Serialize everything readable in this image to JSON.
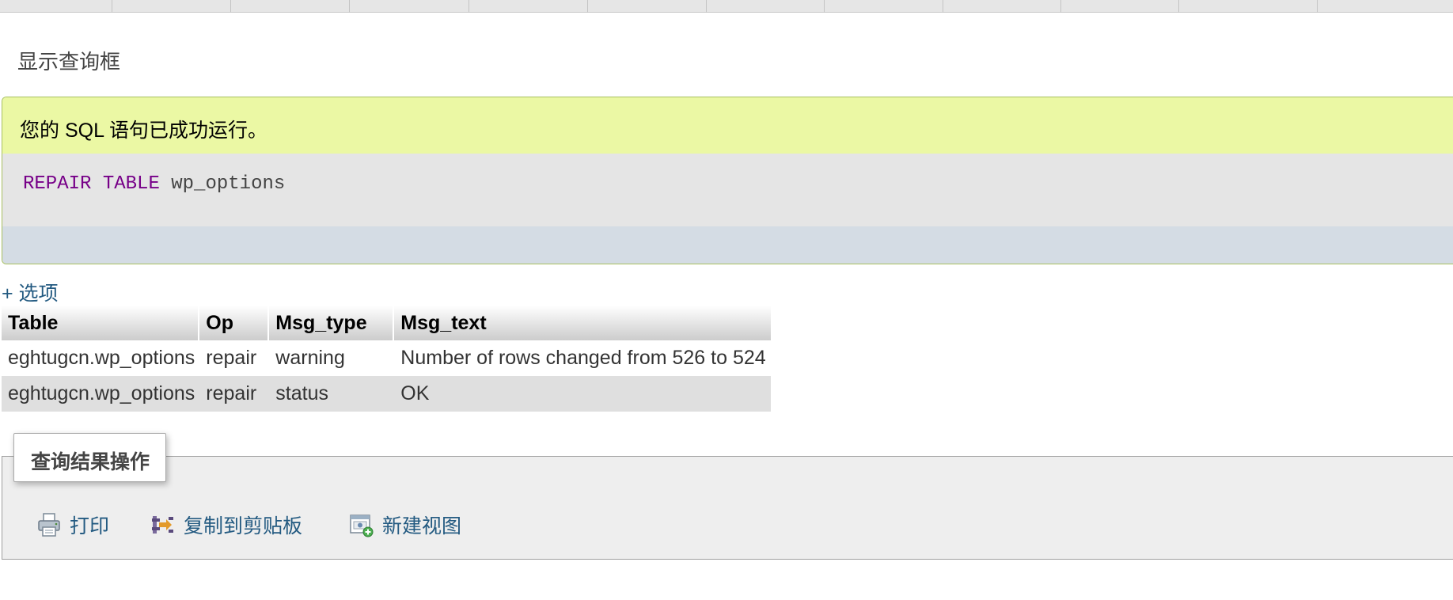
{
  "top_tabs_count": 12,
  "show_query_label": "显示查询框",
  "success_message": "您的 SQL 语句已成功运行。",
  "sql": {
    "keyword1": "REPAIR",
    "keyword2": "TABLE",
    "table_name": "wp_options"
  },
  "options_link": "+ 选项",
  "results": {
    "headers": [
      "Table",
      "Op",
      "Msg_type",
      "Msg_text"
    ],
    "rows": [
      [
        "eghtugcn.wp_options",
        "repair",
        "warning",
        "Number of rows changed from 526 to 524"
      ],
      [
        "eghtugcn.wp_options",
        "repair",
        "status",
        "OK"
      ]
    ]
  },
  "query_ops": {
    "legend": "查询结果操作",
    "actions": [
      {
        "label": "打印",
        "icon": "print-icon"
      },
      {
        "label": "复制到剪贴板",
        "icon": "copy-to-clipboard-icon"
      },
      {
        "label": "新建视图",
        "icon": "create-view-icon"
      }
    ]
  },
  "colors": {
    "success_bg": "#ebf8a4",
    "link": "#235a81",
    "sql_keyword": "#770088"
  }
}
